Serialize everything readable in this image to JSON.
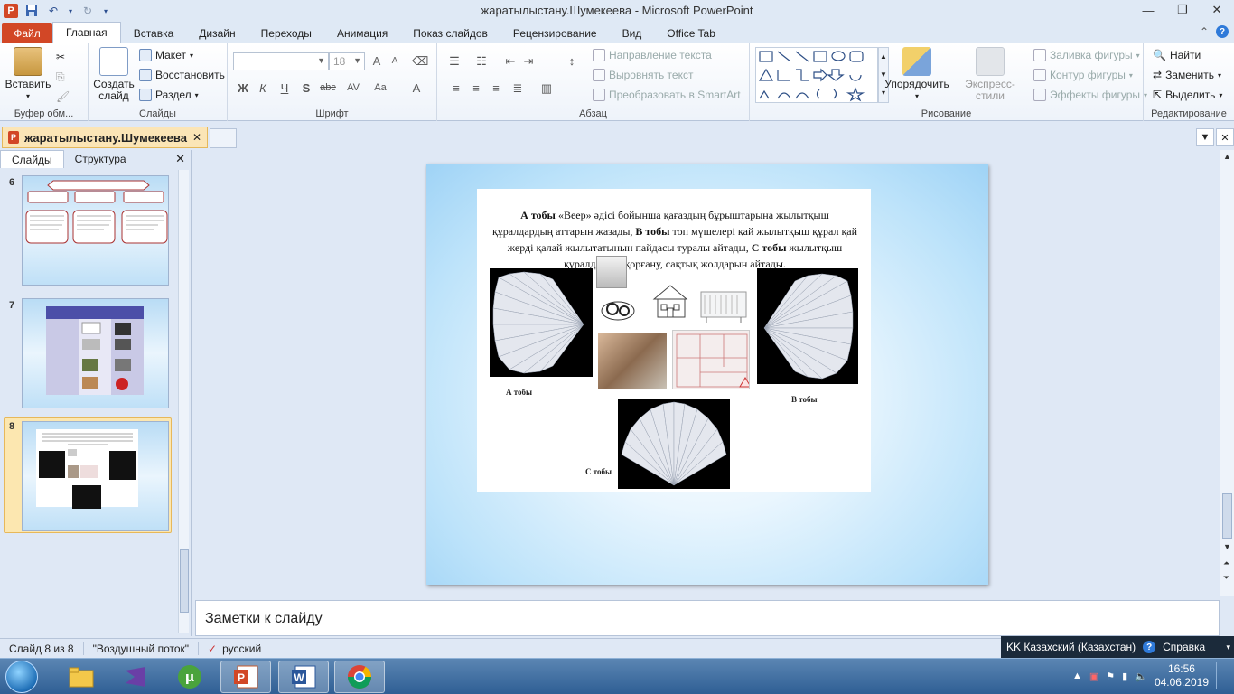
{
  "window": {
    "title": "жаратылыстану.Шумекеева  -  Microsoft PowerPoint",
    "app_icon_letter": "P"
  },
  "ribbon_tabs": {
    "file": "Файл",
    "items": [
      "Главная",
      "Вставка",
      "Дизайн",
      "Переходы",
      "Анимация",
      "Показ слайдов",
      "Рецензирование",
      "Вид",
      "Office Tab"
    ],
    "active_index": 0
  },
  "clipboard": {
    "paste": "Вставить",
    "group_label": "Буфер обм..."
  },
  "slides_group": {
    "new_slide": "Создать слайд",
    "layout": "Макет",
    "reset": "Восстановить",
    "section": "Раздел",
    "group_label": "Слайды"
  },
  "font_group": {
    "font_name": "",
    "font_size": "18",
    "bold": "Ж",
    "italic": "К",
    "underline": "Ч",
    "shadow": "S",
    "strike": "abc",
    "spacing": "AV",
    "case": "Aa",
    "color": "A",
    "grow": "A",
    "shrink": "A",
    "group_label": "Шрифт"
  },
  "paragraph_group": {
    "text_direction": "Направление текста",
    "align_text": "Выровнять текст",
    "smartart": "Преобразовать в SmartArt",
    "group_label": "Абзац"
  },
  "drawing_group": {
    "arrange": "Упорядочить",
    "quick_styles": "Экспресс-стили",
    "shape_fill": "Заливка фигуры",
    "shape_outline": "Контур фигуры",
    "shape_effects": "Эффекты фигуры",
    "group_label": "Рисование"
  },
  "editing_group": {
    "find": "Найти",
    "replace": "Заменить",
    "select": "Выделить",
    "group_label": "Редактирование"
  },
  "doc_tab": {
    "name": "жаратылыстану.Шумекеева"
  },
  "left_pane": {
    "tab_slides": "Слайды",
    "tab_outline": "Структура",
    "slides": [
      {
        "number": "6"
      },
      {
        "number": "7"
      },
      {
        "number": "8"
      }
    ],
    "selected_index": 2
  },
  "slide": {
    "text_parts": [
      {
        "text": "А тобы",
        "bold": true
      },
      {
        "text": " «Веер» әдісі бойынша қағаздың  бұрыштарына жылытқыш құралдардың аттарын жазады, ",
        "bold": false
      },
      {
        "text": "В тобы",
        "bold": true
      },
      {
        "text": " топ мүшелері қай жылытқыш құрал қай жерді қалай жылытатынын пайдасы туралы айтады, ",
        "bold": false
      },
      {
        "text": "С тобы",
        "bold": true
      },
      {
        "text": " жылытқыш құралдардан қорғану, сақтық жолдарын  айтады.",
        "bold": false
      }
    ],
    "label_a": "А тобы",
    "label_b": "В тобы",
    "label_c": "С тобы"
  },
  "notes": {
    "placeholder": "Заметки к слайду"
  },
  "status": {
    "slide_info": "Слайд 8 из 8",
    "theme": "\"Воздушный поток\"",
    "language": "русский"
  },
  "language_bar": {
    "layout": "KK Казахский (Казахстан)",
    "help": "Справка"
  },
  "taskbar": {
    "time": "16:56",
    "date": "04.06.2019",
    "apps": [
      "explorer",
      "visual-studio",
      "utorrent",
      "powerpoint",
      "word",
      "chrome"
    ]
  },
  "colors": {
    "file_tab": "#d24726",
    "doc_tab": "#fbe5b6",
    "selection": "#f7cd6c",
    "taskbar": "#2f5f94"
  }
}
